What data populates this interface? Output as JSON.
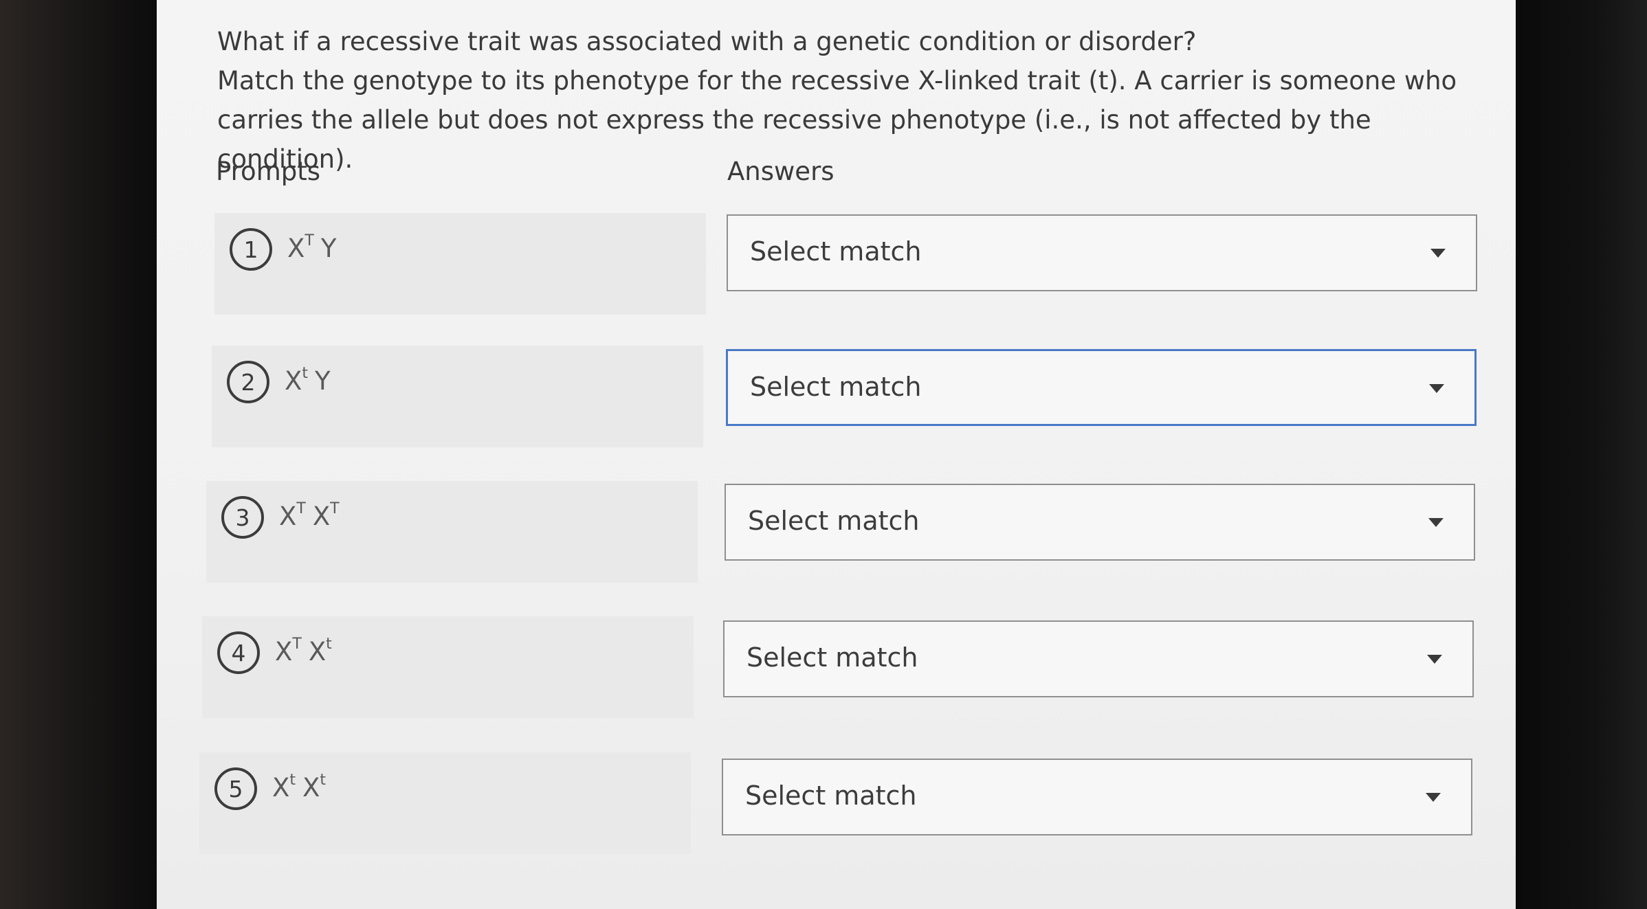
{
  "question": {
    "line1": "What if a recessive trait was associated with a genetic condition or disorder?",
    "line2": "Match the genotype to its phenotype for the recessive X-linked trait (t). A carrier is someone who carries the allele but does not express the recessive phenotype (i.e., is not affected by the condition)."
  },
  "columns": {
    "prompts": "Prompts",
    "answers": "Answers"
  },
  "prompts": [
    {
      "number": "1",
      "a_base": "X",
      "a_sup": "T",
      "b_base": "Y",
      "b_sup": ""
    },
    {
      "number": "2",
      "a_base": "X",
      "a_sup": "t",
      "b_base": "Y",
      "b_sup": ""
    },
    {
      "number": "3",
      "a_base": "X",
      "a_sup": "T",
      "b_base": "X",
      "b_sup": "T"
    },
    {
      "number": "4",
      "a_base": "X",
      "a_sup": "T",
      "b_base": "X",
      "b_sup": "t"
    },
    {
      "number": "5",
      "a_base": "X",
      "a_sup": "t",
      "b_base": "X",
      "b_sup": "t"
    }
  ],
  "answers": [
    {
      "label": "Select match"
    },
    {
      "label": "Select match"
    },
    {
      "label": "Select match"
    },
    {
      "label": "Select match"
    },
    {
      "label": "Select match"
    }
  ],
  "icons": {
    "dropdown": "caret-down-icon"
  },
  "colors": {
    "focus_border": "#4a79c8",
    "prompt_background": "#e9e9e9"
  }
}
